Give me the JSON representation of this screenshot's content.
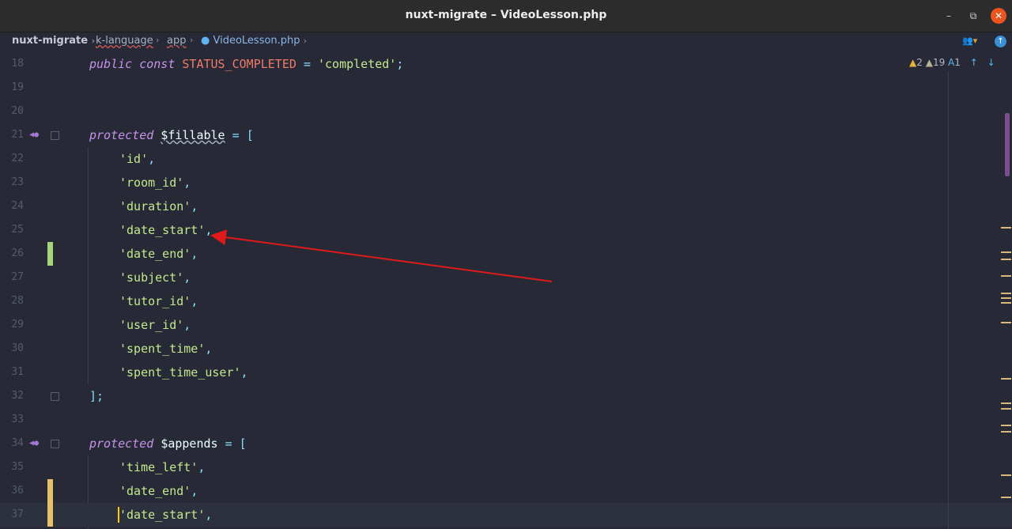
{
  "window": {
    "title": "nuxt-migrate – VideoLesson.php",
    "minimize_icon": "–",
    "maximize_icon": "⧉",
    "close_icon": "✕"
  },
  "breadcrumb": {
    "items": [
      "nuxt-migrate",
      "k-language",
      "app",
      "VideoLesson.php"
    ],
    "separator": "›"
  },
  "inspections": {
    "warnings": "2",
    "weak_warnings": "19",
    "typos": "1"
  },
  "code_lines": {
    "n18": "18",
    "n19": "19",
    "n20": "20",
    "n21": "21",
    "n22": "22",
    "n23": "23",
    "n24": "24",
    "n25": "25",
    "n26": "26",
    "n27": "27",
    "n28": "28",
    "n29": "29",
    "n30": "30",
    "n31": "31",
    "n32": "32",
    "n33": "33",
    "n34": "34",
    "n35": "35",
    "n36": "36",
    "n37": "37"
  },
  "code": {
    "l18_kw": "public const",
    "l18_const": "STATUS_COMPLETED",
    "l18_eq": "=",
    "l18_str": "'completed'",
    "l18_end": ";",
    "l21_kw": "protected",
    "l21_var": "$fillable",
    "l21_eq": "=",
    "l21_br": "[",
    "fillable": [
      "'id'",
      "'room_id'",
      "'duration'",
      "'date_start'",
      "'date_end'",
      "'subject'",
      "'tutor_id'",
      "'user_id'",
      "'spent_time'",
      "'spent_time_user'"
    ],
    "comma": ",",
    "l32_close": "];",
    "l34_kw": "protected",
    "l34_var": "$appends",
    "l34_eq": "=",
    "l34_br": "[",
    "appends": [
      "'time_left'",
      "'date_end'",
      "'date_start'"
    ]
  },
  "colors": {
    "accent_arrow": "#e01a1a",
    "keyword": "#c792ea",
    "string": "#c3e88d",
    "constant": "#ef7b6b"
  }
}
